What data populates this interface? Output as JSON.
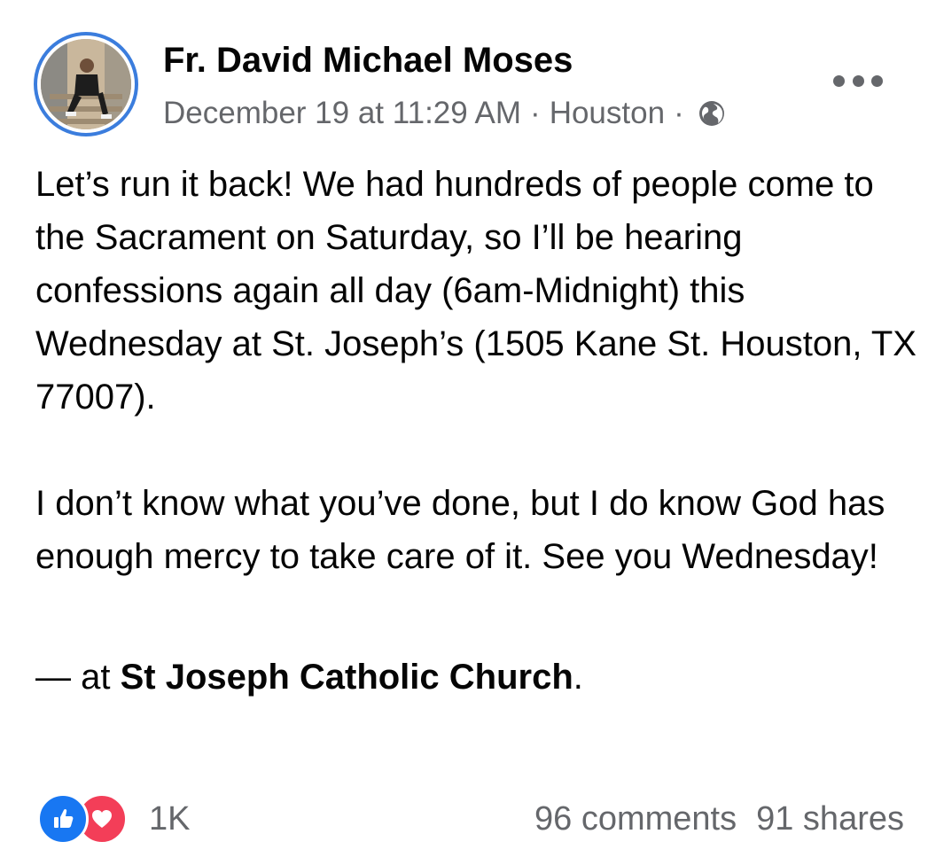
{
  "post": {
    "author": "Fr. David Michael Moses",
    "date": "December 19 at 11:29 AM",
    "separator": "·",
    "location": "Houston",
    "audience_icon": "globe-icon",
    "menu_icon": "more-options-icon",
    "paragraphs": [
      "Let’s run it back! We had hundreds of people come to the Sacrament on Saturday, so I’ll be hearing confessions again all day (6am-Midnight) this Wednesday at St. Joseph’s (1505 Kane St. Houston, TX 77007).",
      "I don’t know what you’ve done, but I do know God has enough mercy to take care of it. See you Wednesday!"
    ],
    "checkin": {
      "prefix": "— at ",
      "place": "St Joseph Catholic Church",
      "suffix": "."
    }
  },
  "engagement": {
    "reactions_count": "1K",
    "reaction_icons": [
      "like-icon",
      "love-icon"
    ],
    "comments": "96 comments",
    "shares": "91 shares"
  },
  "colors": {
    "avatar_ring": "#3b7ddd",
    "secondary_text": "#65676b",
    "like_blue": "#1877f2",
    "love_red": "#f33e58"
  }
}
